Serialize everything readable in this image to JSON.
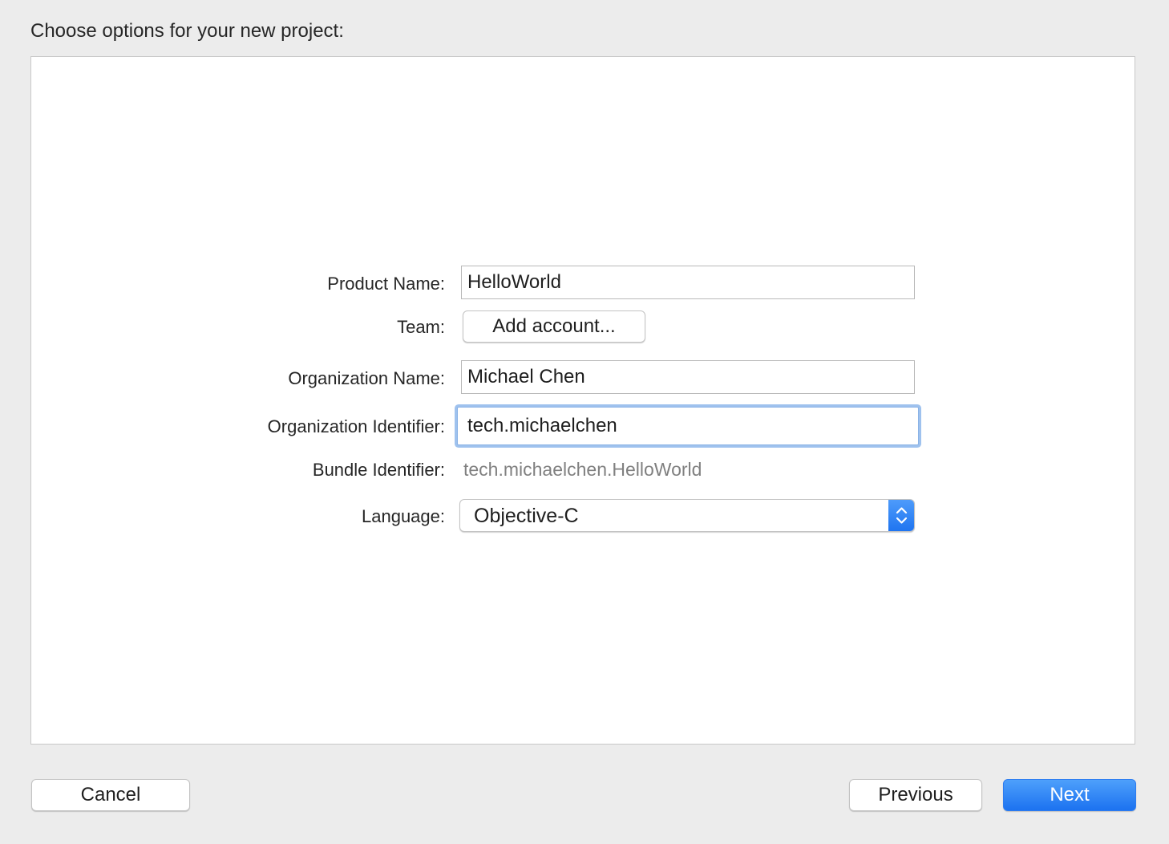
{
  "heading": "Choose options for your new project:",
  "form": {
    "product_name": {
      "label": "Product Name:",
      "value": "HelloWorld"
    },
    "team": {
      "label": "Team:",
      "button_label": "Add account..."
    },
    "organization_name": {
      "label": "Organization Name:",
      "value": "Michael Chen"
    },
    "organization_identifier": {
      "label": "Organization Identifier:",
      "value": "tech.michaelchen",
      "focused": true
    },
    "bundle_identifier": {
      "label": "Bundle Identifier:",
      "value": "tech.michaelchen.HelloWorld"
    },
    "language": {
      "label": "Language:",
      "selected": "Objective-C",
      "icon": "chevron-updown-icon"
    }
  },
  "footer": {
    "cancel_label": "Cancel",
    "previous_label": "Previous",
    "next_label": "Next"
  },
  "colors": {
    "accent": "#1e74f0",
    "focus_ring": "#9fc2ee",
    "window_background": "#ececec",
    "panel_background": "#ffffff",
    "secondary_text": "#808080"
  }
}
